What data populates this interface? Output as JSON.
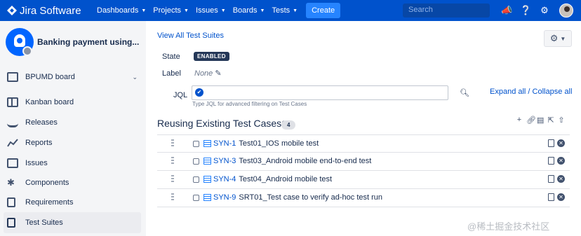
{
  "topnav": {
    "brand": "Jira Software",
    "items": [
      "Dashboards",
      "Projects",
      "Issues",
      "Boards",
      "Tests"
    ],
    "create": "Create",
    "search_placeholder": "Search"
  },
  "sidebar": {
    "project_name": "Banking payment using...",
    "board": "BPUMD board",
    "items": [
      {
        "label": "Kanban board",
        "icon": "kanban-icon"
      },
      {
        "label": "Releases",
        "icon": "ship-icon"
      },
      {
        "label": "Reports",
        "icon": "chart-icon"
      },
      {
        "label": "Issues",
        "icon": "issues-icon"
      },
      {
        "label": "Components",
        "icon": "puzzle-icon"
      },
      {
        "label": "Requirements",
        "icon": "doc-icon"
      },
      {
        "label": "Test Suites",
        "icon": "suite-icon"
      }
    ]
  },
  "main": {
    "view_all": "View All Test Suites",
    "state_label": "State",
    "state_value": "ENABLED",
    "label_label": "Label",
    "label_value": "None",
    "jql_label": "JQL",
    "jql_help": "Type JQL for advanced filtering on Test Cases",
    "expand_all": "Expand all / Collapse all",
    "section_title": "Reusing Existing Test Cases",
    "count": "4",
    "tests": [
      {
        "key": "SYN-1",
        "summary": "Test01_IOS mobile test"
      },
      {
        "key": "SYN-3",
        "summary": "Test03_Android mobile end-to-end test"
      },
      {
        "key": "SYN-4",
        "summary": "Test04_Android mobile test"
      },
      {
        "key": "SYN-9",
        "summary": "SRT01_Test case to verify ad-hoc test run"
      }
    ]
  },
  "watermark": "@稀土掘金技术社区",
  "colors": {
    "nav": "#0052cc",
    "link": "#0052cc",
    "create": "#2684ff"
  }
}
